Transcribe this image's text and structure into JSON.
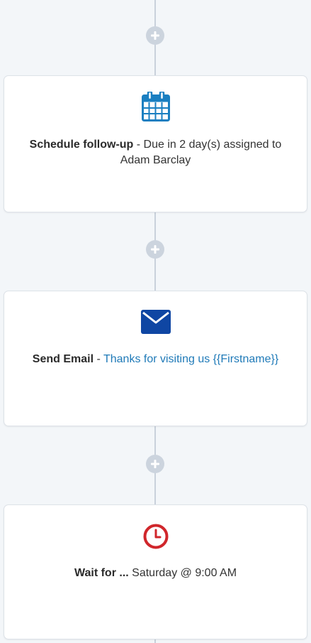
{
  "workflow": {
    "add_step_label": "+",
    "steps": [
      {
        "icon": "calendar-icon",
        "icon_color": "#1a7fc1",
        "title": "Schedule follow-up",
        "separator": " - ",
        "detail": "Due in 2 day(s) assigned to Adam Barclay"
      },
      {
        "icon": "envelope-icon",
        "icon_color": "#0f46a3",
        "title": "Send Email",
        "separator": " - ",
        "detail": "Thanks for visiting us {{Firstname}}",
        "detail_color": "#1f7ab8"
      },
      {
        "icon": "clock-icon",
        "icon_color": "#d0262b",
        "title": "Wait for ...",
        "separator": " ",
        "detail": "Saturday @ 9:00 AM"
      }
    ]
  }
}
